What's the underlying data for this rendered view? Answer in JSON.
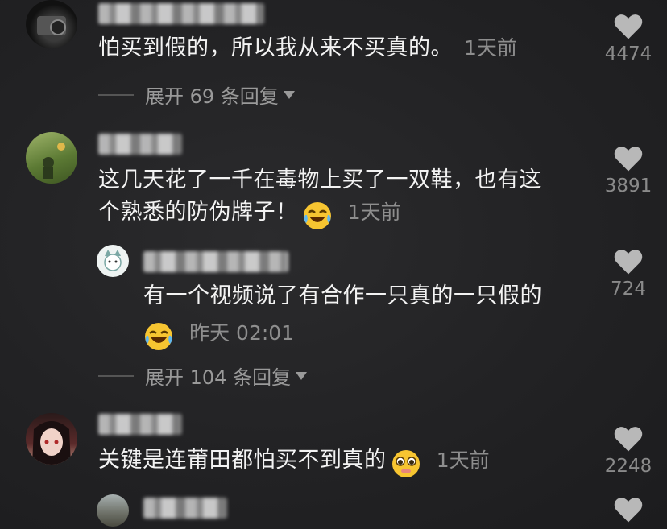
{
  "comments": [
    {
      "text": "怕买到假的，所以我从来不买真的。",
      "time": "1天前",
      "likes": "4474",
      "expand": "展开 69 条回复"
    },
    {
      "text_line1": "这几天花了一千在毒物上买了一双鞋，也有这",
      "text_line2": "个熟悉的防伪牌子！",
      "time": "1天前",
      "likes": "3891",
      "emoji": "laughing-crying-emoji"
    },
    {
      "reply": true,
      "text": "有一个视频说了有合作一只真的一只假的",
      "time": "昨天 02:01",
      "likes": "724",
      "emoji": "laughing-crying-emoji",
      "expand": "展开 104 条回复"
    },
    {
      "text": "关键是连莆田都怕买不到真的",
      "time": "1天前",
      "likes": "2248",
      "emoji": "pleading-emoji"
    }
  ],
  "icons": {
    "like": "heart-icon",
    "caret": "caret-down-icon"
  },
  "colors": {
    "background": "#222224",
    "text": "#f3f3f3",
    "muted": "#8e8e8e",
    "heart": "#b8b8b8"
  }
}
